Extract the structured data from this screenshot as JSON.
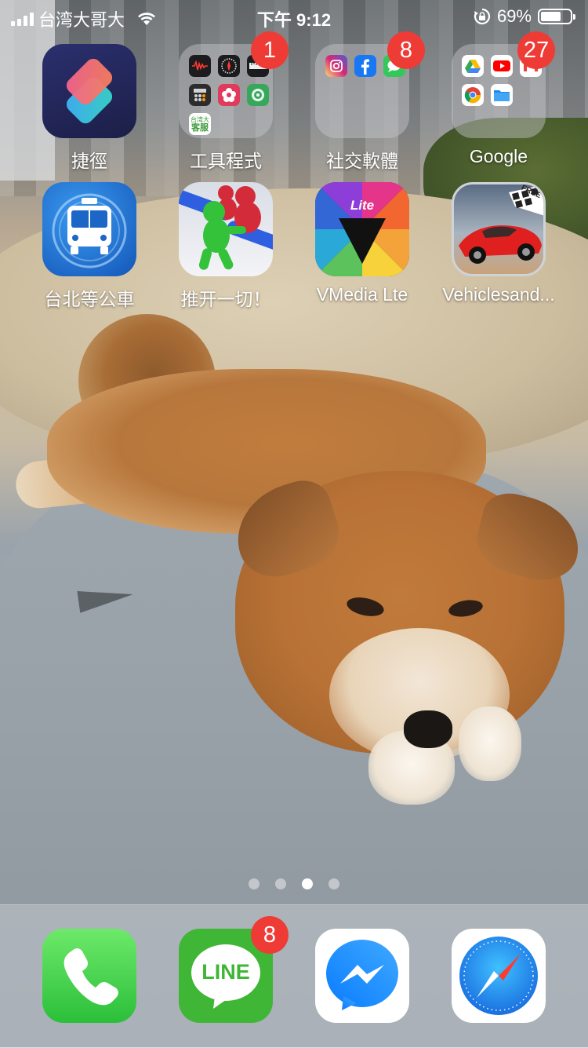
{
  "status_bar": {
    "carrier": "台湾大哥大",
    "time": "下午 9:12",
    "battery_percent_label": "69%",
    "battery_level": 0.69
  },
  "apps": [
    {
      "id": "shortcuts",
      "label": "捷徑",
      "icon": "shortcuts-icon"
    },
    {
      "id": "tools-folder",
      "label": "工具程式",
      "icon": "folder-icon",
      "badge": "1"
    },
    {
      "id": "social-folder",
      "label": "社交軟體",
      "icon": "folder-icon",
      "badge": "8"
    },
    {
      "id": "google-folder",
      "label": "Google",
      "icon": "folder-icon",
      "badge": "27"
    },
    {
      "id": "taipei-bus",
      "label": "台北等公車",
      "icon": "bus-icon"
    },
    {
      "id": "push-game",
      "label": "推开一切！",
      "icon": "runner-game-icon"
    },
    {
      "id": "vmedia",
      "label": "VMedia Lte",
      "icon": "vmedia-icon",
      "icon_text": "Lite"
    },
    {
      "id": "vehicles",
      "label": "Vehiclesand...",
      "icon": "race-car-icon",
      "icon_text": "FREE"
    }
  ],
  "tools_folder_minis": [
    "voice-memos-icon",
    "compass-icon",
    "measure-icon",
    "calculator-icon",
    "flower-app-icon",
    "find-my-icon",
    "weather-alert-icon"
  ],
  "tools_folder_mini_text": [
    "台湾大",
    "客服"
  ],
  "social_folder_minis": [
    "instagram-icon",
    "facebook-icon",
    "messages-icon"
  ],
  "google_folder_minis": [
    "google-drive-icon",
    "youtube-icon",
    "gmail-icon",
    "chrome-icon",
    "files-icon"
  ],
  "page_dots": {
    "count": 4,
    "active_index": 2
  },
  "dock": [
    {
      "id": "phone",
      "icon": "phone-icon"
    },
    {
      "id": "line",
      "icon": "line-icon",
      "icon_text": "LINE",
      "badge": "8"
    },
    {
      "id": "messenger",
      "icon": "messenger-icon"
    },
    {
      "id": "safari",
      "icon": "safari-icon"
    }
  ],
  "colors": {
    "badge": "#ef3b36",
    "line_green": "#3fb635",
    "phone_green": "#4cd964",
    "safari_blue": "#1a8ff0"
  }
}
